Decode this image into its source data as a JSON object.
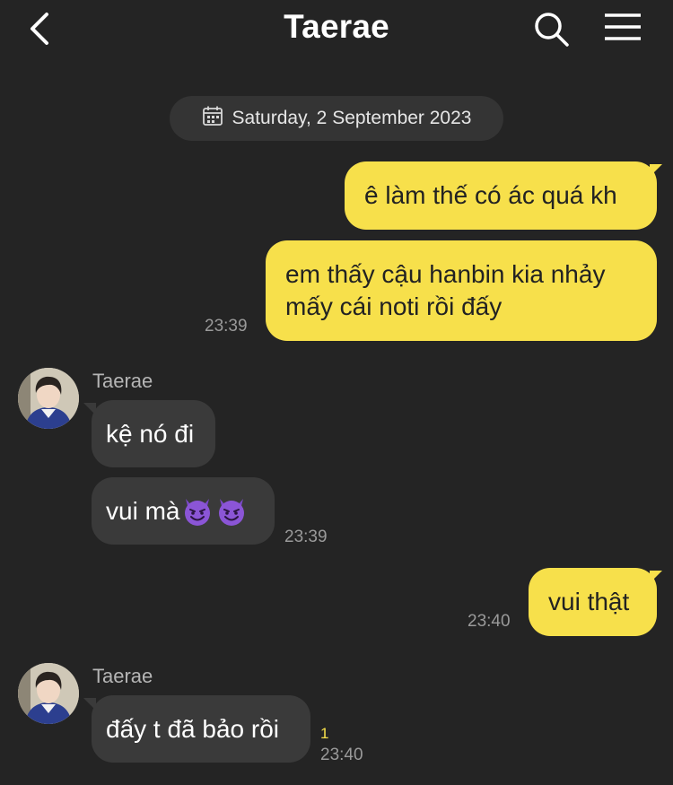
{
  "header": {
    "title": "Taerae",
    "back_icon": "chevron-left-icon",
    "search_icon": "search-icon",
    "menu_icon": "hamburger-menu-icon"
  },
  "date_divider": {
    "text": "Saturday, 2 September 2023",
    "icon": "calendar-icon"
  },
  "messages": [
    {
      "direction": "out",
      "text": "ê làm thế có ác quá kh",
      "time": ""
    },
    {
      "direction": "out",
      "lines": [
        "em thấy cậu hanbin kia nhảy",
        "mấy cái noti rồi đấy"
      ],
      "time": "23:39"
    },
    {
      "direction": "in",
      "sender": "Taerae",
      "text": "kệ nó đi",
      "time": ""
    },
    {
      "direction": "in",
      "text": "vui mà",
      "emoji": "smiling-devil-emoji",
      "emoji_count": 2,
      "time": "23:39"
    },
    {
      "direction": "out",
      "text": "vui thật",
      "time": "23:40"
    },
    {
      "direction": "in",
      "sender": "Taerae",
      "text": "đấy t đã bảo rồi",
      "time": "23:40",
      "unread_count": "1"
    }
  ],
  "colors": {
    "background": "#242424",
    "outgoing_bubble": "#f7e04b",
    "incoming_bubble": "#3a3a3a",
    "unread": "#f7e04b"
  }
}
